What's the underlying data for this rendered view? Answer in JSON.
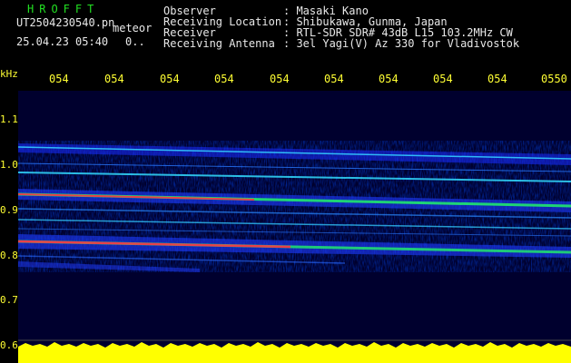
{
  "app": {
    "title": "HROFFT",
    "filename": "UT2504230540.pn",
    "mode": "meteor",
    "datetime": "25.04.23 05:40",
    "counter": "0.."
  },
  "info": [
    {
      "label": "Observer",
      "value": ": Masaki Kano"
    },
    {
      "label": "Receiving Location",
      "value": ": Shibukawa, Gunma, Japan"
    },
    {
      "label": "Receiver",
      "value": ": RTL-SDR SDR# 43dB L15 103.2MHz CW"
    },
    {
      "label": "Receiving Antenna",
      "value": ": 3el Yagi(V) Az 330 for Vladivostok"
    }
  ],
  "axis": {
    "unit": "kHz",
    "x_ticks": [
      "054",
      "054",
      "054",
      "054",
      "054",
      "054",
      "054",
      "054",
      "054",
      "0550"
    ],
    "y_ticks": [
      "1.1",
      "1.0",
      "0.9",
      "0.8",
      "0.7",
      "0.6"
    ]
  },
  "colors": {
    "label": "#ffff33",
    "title": "#22e022",
    "background": "#00003a",
    "level": "#ffff00"
  }
}
